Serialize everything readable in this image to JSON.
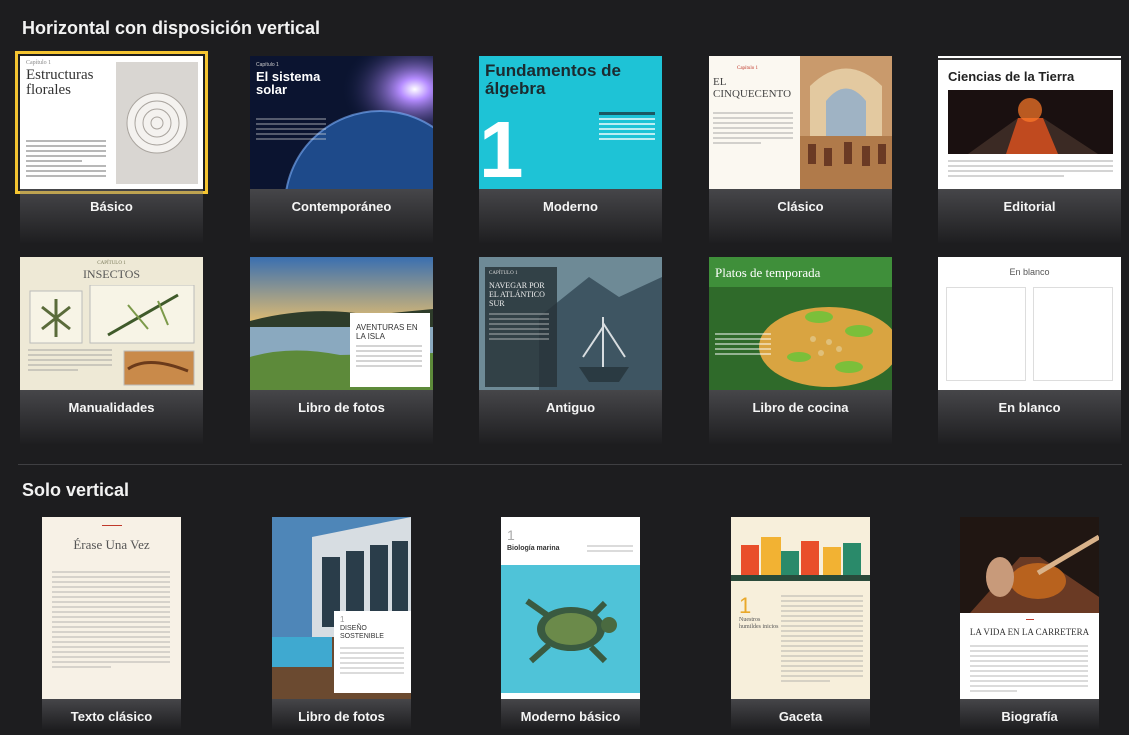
{
  "sections": {
    "landscape_title": "Horizontal con disposición vertical",
    "portrait_title": "Solo vertical"
  },
  "landscape_templates": [
    {
      "label": "Básico",
      "thumb_title": "Estructuras florales",
      "thumb_tag": "Capítulo 1"
    },
    {
      "label": "Contemporáneo",
      "thumb_title": "El sistema solar",
      "thumb_tag": "Capítulo 1"
    },
    {
      "label": "Moderno",
      "thumb_title": "Fundamentos de álgebra",
      "thumb_number": "1"
    },
    {
      "label": "Clásico",
      "thumb_title": "EL CINQUECENTO",
      "thumb_tag": "Capítulo 1"
    },
    {
      "label": "Editorial",
      "thumb_title": "Ciencias de la Tierra"
    },
    {
      "label": "Manualidades",
      "thumb_title": "INSECTOS",
      "thumb_tag": "CAPÍTULO 1"
    },
    {
      "label": "Libro de fotos",
      "thumb_title": "AVENTURAS EN LA ISLA"
    },
    {
      "label": "Antiguo",
      "thumb_title": "NAVEGAR POR EL ATLÁNTICO SUR",
      "thumb_tag": "CAPÍTULO 1"
    },
    {
      "label": "Libro de cocina",
      "thumb_title": "Platos de temporada"
    },
    {
      "label": "En blanco",
      "thumb_title": "En blanco"
    }
  ],
  "portrait_templates": [
    {
      "label": "Texto clásico",
      "thumb_title": "Érase Una Vez"
    },
    {
      "label": "Libro de fotos",
      "thumb_title": "DISEÑO SOSTENIBLE",
      "thumb_number": "1"
    },
    {
      "label": "Moderno básico",
      "thumb_title": "Biología marina",
      "thumb_number": "1"
    },
    {
      "label": "Gaceta",
      "thumb_title": "Nuestros humildes inicios",
      "thumb_number": "1"
    },
    {
      "label": "Biografía",
      "thumb_title": "LA VIDA EN LA CARRETERA"
    }
  ],
  "colors": {
    "background": "#1d1d1f",
    "selection": "#f4c431",
    "moderno_cyan": "#1ec3d6",
    "cocina_green": "#3f8f3a"
  }
}
